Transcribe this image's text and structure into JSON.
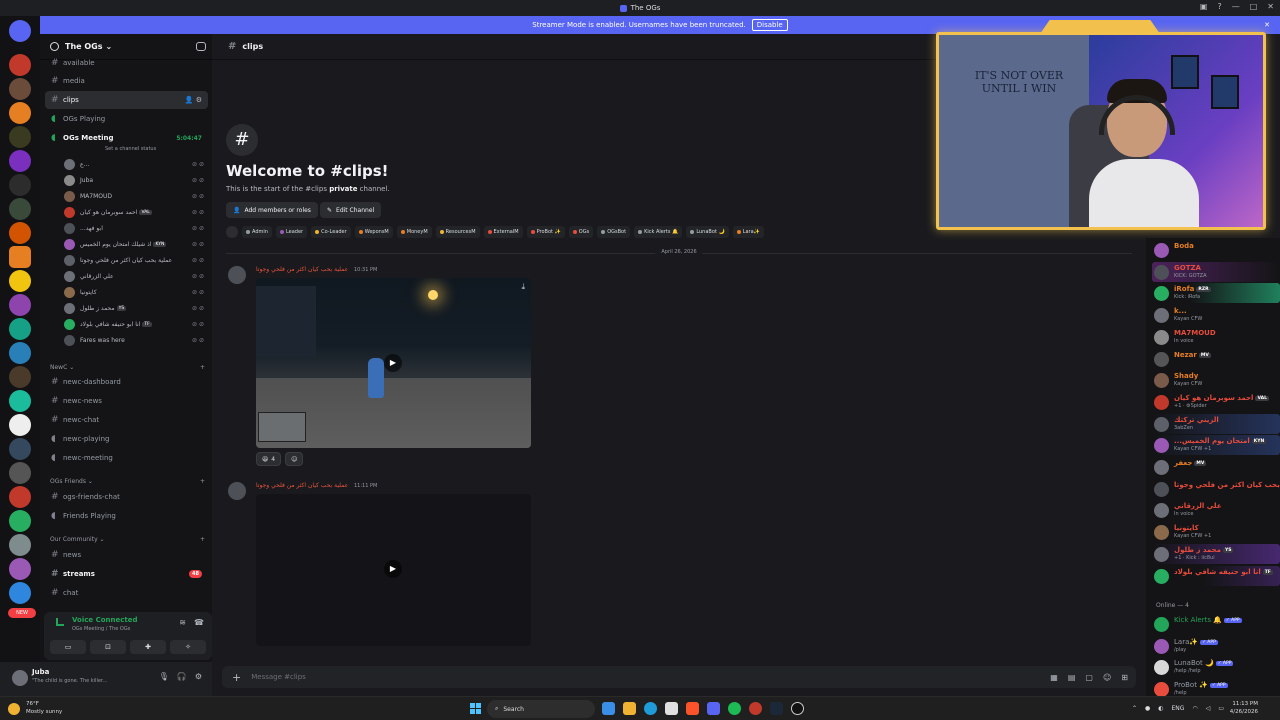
{
  "window": {
    "title": "The OGs"
  },
  "banner": {
    "text": "Streamer Mode is enabled. Usernames have been truncated.",
    "disable_label": "Disable"
  },
  "guild": {
    "name": "The OGs"
  },
  "channels": {
    "items": [
      {
        "label": "available"
      },
      {
        "label": "media"
      },
      {
        "label": "clips"
      },
      {
        "label": "OGs Playing"
      },
      {
        "label": "OGs Meeting",
        "timer": "5:04:47",
        "status": "Set a channel status"
      }
    ],
    "voice_users": [
      "ع...",
      "Juba",
      "MA7MOUD",
      "احمد سوبرمان هو كيان",
      "...ابو فهد",
      "اذ شيلك امتحان يوم الخميس",
      "عملية بحب كيان اكثر من فلحي وجوتا",
      "علي الزرقاني",
      "كايتونيا",
      "محمد ز طلول",
      "انا ابو حنيفه شافي بلولاد",
      "Fares was here"
    ],
    "voice_tags": [
      "",
      "",
      "",
      "VAL",
      "",
      "KYN",
      "",
      "",
      "",
      "YS",
      "TF",
      ""
    ],
    "cat_newc": "NewC",
    "newc": [
      "newc-dashboard",
      "newc-news",
      "newc-chat",
      "newc-playing",
      "newc-meeting"
    ],
    "cat_friends": "OGs Friends",
    "friends": [
      "ogs-friends-chat",
      "Friends Playing"
    ],
    "cat_community": "Our Community",
    "community": [
      "news",
      "streams",
      "chat"
    ],
    "streams_badge": "48"
  },
  "voice": {
    "status": "Voice Connected",
    "location": "OGs Meeting / The OGs"
  },
  "user": {
    "name": "Juba",
    "status": "\"The child is gone. The killer..."
  },
  "channel": {
    "name": "clips",
    "welcome_title": "Welcome to #clips!",
    "welcome_sub_a": "This is the start of the #clips ",
    "welcome_sub_b": "private",
    "welcome_sub_c": " channel.",
    "add_members": "Add members or roles",
    "edit_channel": "Edit Channel",
    "roles": [
      {
        "name": "Admin",
        "color": "#949ba4"
      },
      {
        "name": "Leader",
        "color": "#9b59b6"
      },
      {
        "name": "Co-Leader",
        "color": "#f0b232"
      },
      {
        "name": "WeponsM",
        "color": "#e67e22"
      },
      {
        "name": "MoneyM",
        "color": "#e67e22"
      },
      {
        "name": "ResourcesM",
        "color": "#f0b232"
      },
      {
        "name": "ExternalM",
        "color": "#e74c3c"
      },
      {
        "name": "ProBot ✨",
        "color": "#e74c3c"
      },
      {
        "name": "OGs",
        "color": "#e74c3c"
      },
      {
        "name": "OGsBot",
        "color": "#949ba4"
      },
      {
        "name": "Kick Alerts 🔔",
        "color": "#949ba4"
      },
      {
        "name": "LunaBot 🌙",
        "color": "#949ba4"
      },
      {
        "name": "Lara✨",
        "color": "#e67e22"
      }
    ],
    "date_divider": "April 26, 2026",
    "msg1": {
      "author": "عملية بحب كيان اكثر من فلحي وجوتا",
      "time": "10:31 PM",
      "reaction_count": "4"
    },
    "msg2": {
      "author": "عملية بحب كيان اكثر من فلحي وجوتا",
      "time": "11:11 PM"
    },
    "composer_placeholder": "Message #clips"
  },
  "webcam": {
    "quote": "IT'S NOT OVER UNTIL I WIN"
  },
  "members": [
    {
      "name": "Boda",
      "status": "",
      "color": "#e67e22",
      "tag": ""
    },
    {
      "name": "GOTZA",
      "status": "KICK: GOTZA",
      "color": "#e74c3c",
      "tag": ""
    },
    {
      "name": "iRofa",
      "status": "Kick: iRofa",
      "color": "#e67e22",
      "tag": "RZR"
    },
    {
      "name": "k...",
      "status": "Kayan CFW",
      "color": "#e67e22",
      "tag": ""
    },
    {
      "name": "MA7MOUD",
      "status": "In voice",
      "color": "#e74c3c",
      "tag": ""
    },
    {
      "name": "Nezar",
      "status": "",
      "color": "#e67e22",
      "tag": "MV"
    },
    {
      "name": "Shady",
      "status": "Kayan CFW",
      "color": "#e67e22",
      "tag": ""
    },
    {
      "name": "احمد سوبرمان هو كيان",
      "status": "+1 · ⚙Spider",
      "color": "#e74c3c",
      "tag": "VAL"
    },
    {
      "name": "الزيني تركتك",
      "status": "3abZen",
      "color": "#e74c3c",
      "tag": ""
    },
    {
      "name": "...امتحان يوم الخميس",
      "status": "Kayan CFW +1",
      "color": "#e74c3c",
      "tag": "KYN"
    },
    {
      "name": "جعفر",
      "status": "",
      "color": "#e67e22",
      "tag": "MV"
    },
    {
      "name": "عملية بحب كيان اكثر من فلحي وجوتا",
      "status": "",
      "color": "#e74c3c",
      "tag": ""
    },
    {
      "name": "علي الزرقاني",
      "status": "In voice",
      "color": "#e74c3c",
      "tag": ""
    },
    {
      "name": "كايتونيا",
      "status": "Kayan CFW +1",
      "color": "#e74c3c",
      "tag": ""
    },
    {
      "name": "محمد ز طلول",
      "status": "+1 · Kick : iic8ui",
      "color": "#e74c3c",
      "tag": "YS"
    },
    {
      "name": "انا ابو حنيفه شافي بلولاد",
      "status": "",
      "color": "#e74c3c",
      "tag": "TF"
    }
  ],
  "online_header": "Online — 4",
  "bots": [
    {
      "name": "Kick Alerts 🔔",
      "status": "",
      "color": "#23a55a"
    },
    {
      "name": "Lara✨",
      "status": "/play",
      "color": "#949ba4"
    },
    {
      "name": "LunaBot 🌙",
      "status": "/help /help",
      "color": "#949ba4"
    },
    {
      "name": "ProBot ✨",
      "status": "/help",
      "color": "#949ba4"
    }
  ],
  "bot_badge": "✓ APP",
  "taskbar": {
    "temp": "76°F",
    "weather": "Mostly sunny",
    "search": "Search",
    "lang": "ENG",
    "time": "11:13 PM",
    "date": "4/26/2026"
  },
  "server_badges": [
    "NEW"
  ]
}
